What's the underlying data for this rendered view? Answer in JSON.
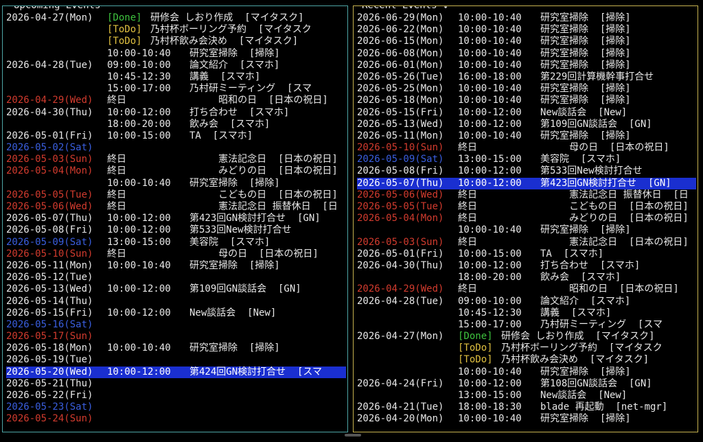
{
  "upcoming": {
    "title": "Upcoming Events",
    "rows": [
      {
        "date": "2026-04-27(Mon)",
        "kind": "wd",
        "tag": "[Done]",
        "tagkind": "done",
        "title": "研修会 しおり作成  [マイタスク]"
      },
      {
        "date": "",
        "kind": "wd",
        "tag": "[ToDo]",
        "tagkind": "todo",
        "title": "乃村杯ボーリング予約  [マイタスク"
      },
      {
        "date": "",
        "kind": "wd",
        "tag": "[ToDo]",
        "tagkind": "todo",
        "title": "乃村杯飲み会決め  [マイタスク]"
      },
      {
        "date": "",
        "kind": "wd",
        "time": "10:00-10:40",
        "title": "研究室掃除  [掃除]"
      },
      {
        "date": "2026-04-28(Tue)",
        "kind": "wd",
        "time": "09:00-10:00",
        "title": "論文紹介  [スマホ]"
      },
      {
        "date": "",
        "kind": "wd",
        "time": "10:45-12:30",
        "title": "講義  [スマホ]"
      },
      {
        "date": "",
        "kind": "wd",
        "time": "15:00-17:00",
        "title": "乃村研ミーティング  [スマ"
      },
      {
        "date": "2026-04-29(Wed)",
        "kind": "hol",
        "time": "終日",
        "title": "     昭和の日  [日本の祝日]"
      },
      {
        "date": "2026-04-30(Thu)",
        "kind": "wd",
        "time": "10:00-12:00",
        "title": "打ち合わせ  [スマホ]"
      },
      {
        "date": "",
        "kind": "wd",
        "time": "18:00-20:00",
        "title": "飲み会  [スマホ]"
      },
      {
        "date": "2026-05-01(Fri)",
        "kind": "wd",
        "time": "10:00-15:00",
        "title": "TA  [スマホ]"
      },
      {
        "date": "2026-05-02(Sat)",
        "kind": "sat",
        "time": "",
        "title": ""
      },
      {
        "date": "2026-05-03(Sun)",
        "kind": "sun",
        "time": "終日",
        "title": "     憲法記念日  [日本の祝日]"
      },
      {
        "date": "2026-05-04(Mon)",
        "kind": "hol",
        "time": "終日",
        "title": "     みどりの日  [日本の祝日]"
      },
      {
        "date": "",
        "kind": "wd",
        "time": "10:00-10:40",
        "title": "研究室掃除  [掃除]"
      },
      {
        "date": "2026-05-05(Tue)",
        "kind": "hol",
        "time": "終日",
        "title": "     こどもの日  [日本の祝日]"
      },
      {
        "date": "2026-05-06(Wed)",
        "kind": "hol",
        "time": "終日",
        "title": "     憲法記念日 振替休日  [日"
      },
      {
        "date": "2026-05-07(Thu)",
        "kind": "wd",
        "time": "10:00-12:00",
        "title": "第423回GN検討打合せ  [GN]"
      },
      {
        "date": "2026-05-08(Fri)",
        "kind": "wd",
        "time": "10:00-12:00",
        "title": "第533回New検討打合せ"
      },
      {
        "date": "2026-05-09(Sat)",
        "kind": "sat",
        "time": "13:00-15:00",
        "title": "美容院  [スマホ]"
      },
      {
        "date": "2026-05-10(Sun)",
        "kind": "sun",
        "time": "終日",
        "title": "     母の日  [日本の祝日]"
      },
      {
        "date": "2026-05-11(Mon)",
        "kind": "wd",
        "time": "10:00-10:40",
        "title": "研究室掃除  [掃除]"
      },
      {
        "date": "2026-05-12(Tue)",
        "kind": "wd",
        "time": "",
        "title": ""
      },
      {
        "date": "2026-05-13(Wed)",
        "kind": "wd",
        "time": "10:00-12:00",
        "title": "第109回GN談話会  [GN]"
      },
      {
        "date": "2026-05-14(Thu)",
        "kind": "wd",
        "time": "",
        "title": ""
      },
      {
        "date": "2026-05-15(Fri)",
        "kind": "wd",
        "time": "10:00-12:00",
        "title": "New談話会  [New]"
      },
      {
        "date": "2026-05-16(Sat)",
        "kind": "sat",
        "time": "",
        "title": ""
      },
      {
        "date": "2026-05-17(Sun)",
        "kind": "sun",
        "time": "",
        "title": ""
      },
      {
        "date": "2026-05-18(Mon)",
        "kind": "wd",
        "time": "10:00-10:40",
        "title": "研究室掃除  [掃除]"
      },
      {
        "date": "2026-05-19(Tue)",
        "kind": "wd",
        "time": "",
        "title": ""
      },
      {
        "date": "2026-05-20(Wed)",
        "kind": "wd",
        "time": "10:00-12:00",
        "title": "第424回GN検討打合せ  [スマ",
        "selected": true
      },
      {
        "date": "2026-05-21(Thu)",
        "kind": "wd",
        "time": "",
        "title": ""
      },
      {
        "date": "2026-05-22(Fri)",
        "kind": "wd",
        "time": "",
        "title": ""
      },
      {
        "date": "2026-05-23(Sat)",
        "kind": "sat",
        "time": "",
        "title": ""
      },
      {
        "date": "2026-05-24(Sun)",
        "kind": "sun",
        "time": "",
        "title": ""
      }
    ]
  },
  "recent": {
    "title": "Recent Events ↓",
    "rows": [
      {
        "date": "2026-06-29(Mon)",
        "kind": "wd",
        "time": "10:00-10:40",
        "title": "研究室掃除  [掃除]"
      },
      {
        "date": "2026-06-22(Mon)",
        "kind": "wd",
        "time": "10:00-10:40",
        "title": "研究室掃除  [掃除]"
      },
      {
        "date": "2026-06-15(Mon)",
        "kind": "wd",
        "time": "10:00-10:40",
        "title": "研究室掃除  [掃除]"
      },
      {
        "date": "2026-06-08(Mon)",
        "kind": "wd",
        "time": "10:00-10:40",
        "title": "研究室掃除  [掃除]"
      },
      {
        "date": "2026-06-01(Mon)",
        "kind": "wd",
        "time": "10:00-10:40",
        "title": "研究室掃除  [掃除]"
      },
      {
        "date": "2026-05-26(Tue)",
        "kind": "wd",
        "time": "16:00-18:00",
        "title": "第229回計算機幹事打合せ"
      },
      {
        "date": "2026-05-25(Mon)",
        "kind": "wd",
        "time": "10:00-10:40",
        "title": "研究室掃除  [掃除]"
      },
      {
        "date": "2026-05-18(Mon)",
        "kind": "wd",
        "time": "10:00-10:40",
        "title": "研究室掃除  [掃除]"
      },
      {
        "date": "2026-05-15(Fri)",
        "kind": "wd",
        "time": "10:00-12:00",
        "title": "New談話会  [New]"
      },
      {
        "date": "2026-05-13(Wed)",
        "kind": "wd",
        "time": "10:00-12:00",
        "title": "第109回GN談話会  [GN]"
      },
      {
        "date": "2026-05-11(Mon)",
        "kind": "wd",
        "time": "10:00-10:40",
        "title": "研究室掃除  [掃除]"
      },
      {
        "date": "2026-05-10(Sun)",
        "kind": "sun",
        "time": "終日",
        "title": "     母の日  [日本の祝日]"
      },
      {
        "date": "2026-05-09(Sat)",
        "kind": "sat",
        "time": "13:00-15:00",
        "title": "美容院  [スマホ]"
      },
      {
        "date": "2026-05-08(Fri)",
        "kind": "wd",
        "time": "10:00-12:00",
        "title": "第533回New検討打合せ"
      },
      {
        "date": "2026-05-07(Thu)",
        "kind": "wd",
        "time": "10:00-12:00",
        "title": "第423回GN検討打合せ  [GN]",
        "selected": true
      },
      {
        "date": "2026-05-06(Wed)",
        "kind": "hol",
        "time": "終日",
        "title": "     憲法記念日 振替休日  [日"
      },
      {
        "date": "2026-05-05(Tue)",
        "kind": "hol",
        "time": "終日",
        "title": "     こどもの日  [日本の祝日]"
      },
      {
        "date": "2026-05-04(Mon)",
        "kind": "hol",
        "time": "終日",
        "title": "     みどりの日  [日本の祝日]"
      },
      {
        "date": "",
        "kind": "wd",
        "time": "10:00-10:40",
        "title": "研究室掃除  [掃除]"
      },
      {
        "date": "2026-05-03(Sun)",
        "kind": "sun",
        "time": "終日",
        "title": "     憲法記念日  [日本の祝日]"
      },
      {
        "date": "2026-05-01(Fri)",
        "kind": "wd",
        "time": "10:00-15:00",
        "title": "TA  [スマホ]"
      },
      {
        "date": "2026-04-30(Thu)",
        "kind": "wd",
        "time": "10:00-12:00",
        "title": "打ち合わせ  [スマホ]"
      },
      {
        "date": "",
        "kind": "wd",
        "time": "18:00-20:00",
        "title": "飲み会  [スマホ]"
      },
      {
        "date": "2026-04-29(Wed)",
        "kind": "hol",
        "time": "終日",
        "title": "     昭和の日  [日本の祝日]"
      },
      {
        "date": "2026-04-28(Tue)",
        "kind": "wd",
        "time": "09:00-10:00",
        "title": "論文紹介  [スマホ]"
      },
      {
        "date": "",
        "kind": "wd",
        "time": "10:45-12:30",
        "title": "講義  [スマホ]"
      },
      {
        "date": "",
        "kind": "wd",
        "time": "15:00-17:00",
        "title": "乃村研ミーティング  [スマ"
      },
      {
        "date": "2026-04-27(Mon)",
        "kind": "wd",
        "tag": "[Done]",
        "tagkind": "done",
        "title": "研修会 しおり作成  [マイタスク]"
      },
      {
        "date": "",
        "kind": "wd",
        "tag": "[ToDo]",
        "tagkind": "todo",
        "title": "乃村杯ボーリング予約  [マイタスク"
      },
      {
        "date": "",
        "kind": "wd",
        "tag": "[ToDo]",
        "tagkind": "todo",
        "title": "乃村杯飲み会決め  [マイタスク]"
      },
      {
        "date": "",
        "kind": "wd",
        "time": "10:00-10:40",
        "title": "研究室掃除  [掃除]"
      },
      {
        "date": "2026-04-24(Fri)",
        "kind": "wd",
        "time": "10:00-12:00",
        "title": "第108回GN談話会  [GN]"
      },
      {
        "date": "",
        "kind": "wd",
        "time": "13:00-15:00",
        "title": "New談話会  [New]"
      },
      {
        "date": "2026-04-21(Tue)",
        "kind": "wd",
        "time": "18:00-18:30",
        "title": "blade 再起動  [net-mgr]"
      },
      {
        "date": "2026-04-20(Mon)",
        "kind": "wd",
        "time": "10:00-10:40",
        "title": "研究室掃除  [掃除]"
      }
    ]
  }
}
